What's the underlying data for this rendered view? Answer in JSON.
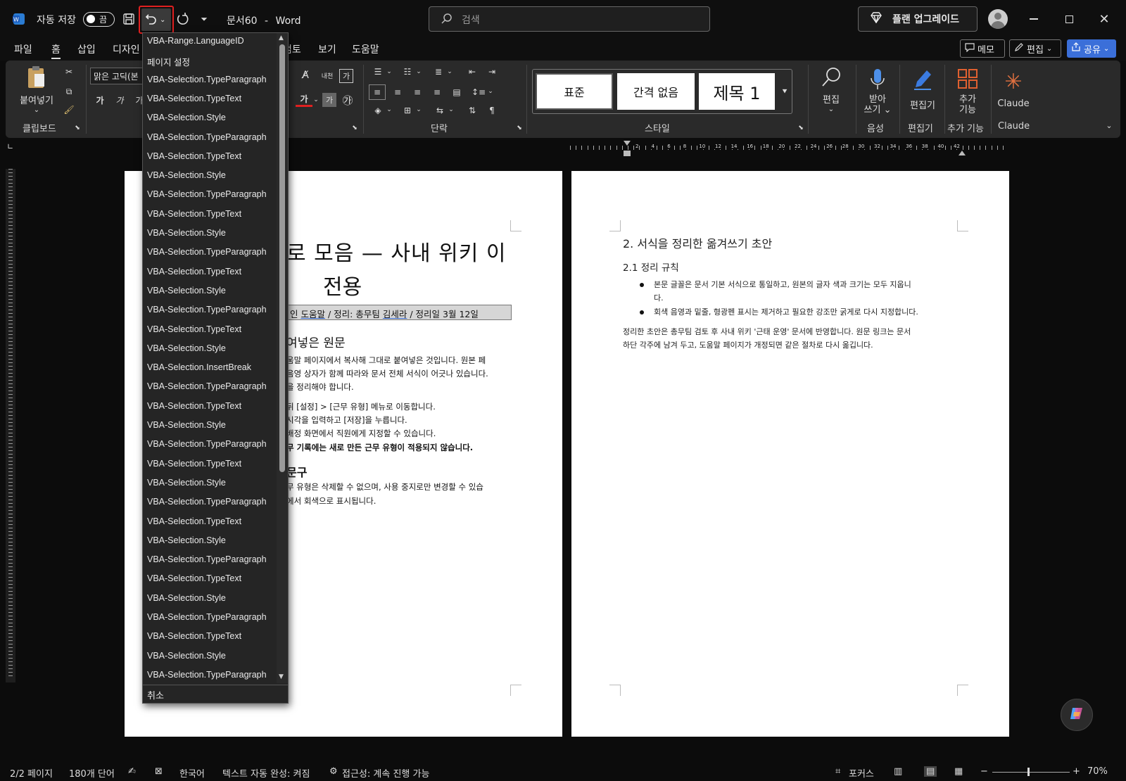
{
  "titlebar": {
    "autosave_label": "자동 저장",
    "autosave_state": "끔",
    "doc_title": "문서60",
    "separator": "-",
    "app_name": "Word",
    "search_placeholder": "검색",
    "upgrade_label": "플랜 업그레이드"
  },
  "menu": {
    "tabs": [
      "파일",
      "홈",
      "삽입",
      "디자인",
      "검토",
      "보기",
      "도움말"
    ],
    "active_tab": "홈",
    "memo_label": "메모",
    "edit_label": "편집",
    "share_label": "공유"
  },
  "ribbon": {
    "clipboard": {
      "paste": "붙여넣기",
      "group_label": "클립보드"
    },
    "font": {
      "font_name": "맑은 고딕(본",
      "bold": "가",
      "italic": "가",
      "underline": "가",
      "color": "가",
      "shade": "가",
      "hanja": "내천",
      "char_box": "가"
    },
    "paragraph": {
      "group_label": "단락"
    },
    "styles": {
      "items": [
        "표준",
        "간격 없음",
        "제목 1"
      ],
      "group_label": "스타일"
    },
    "editing": {
      "label": "편집"
    },
    "voice": {
      "label": "받아\n쓰기",
      "group_label": "음성"
    },
    "editor": {
      "label": "편집기",
      "group_label": "편집기"
    },
    "addins": {
      "label": "추가\n기능",
      "group_label": "추가 기능"
    },
    "claude": {
      "label": "Claude",
      "group_label": "Claude"
    }
  },
  "ruler_numbers": [
    "2",
    "4",
    "6",
    "8",
    "10",
    "12",
    "14",
    "16",
    "18",
    "20",
    "22",
    "24",
    "26",
    "28",
    "30",
    "32",
    "34",
    "36",
    "38",
    "40",
    "42"
  ],
  "undo_dropdown": {
    "items": [
      "VBA-Range.LanguageID",
      "페이지 설정",
      "VBA-Selection.TypeParagraph",
      "VBA-Selection.TypeText",
      "VBA-Selection.Style",
      "VBA-Selection.TypeParagraph",
      "VBA-Selection.TypeText",
      "VBA-Selection.Style",
      "VBA-Selection.TypeParagraph",
      "VBA-Selection.TypeText",
      "VBA-Selection.Style",
      "VBA-Selection.TypeParagraph",
      "VBA-Selection.TypeText",
      "VBA-Selection.Style",
      "VBA-Selection.TypeParagraph",
      "VBA-Selection.TypeText",
      "VBA-Selection.Style",
      "VBA-Selection.InsertBreak",
      "VBA-Selection.TypeParagraph",
      "VBA-Selection.TypeText",
      "VBA-Selection.Style",
      "VBA-Selection.TypeParagraph",
      "VBA-Selection.TypeText",
      "VBA-Selection.Style",
      "VBA-Selection.TypeParagraph",
      "VBA-Selection.TypeText",
      "VBA-Selection.Style",
      "VBA-Selection.TypeParagraph",
      "VBA-Selection.TypeText",
      "VBA-Selection.Style",
      "VBA-Selection.TypeParagraph",
      "VBA-Selection.TypeText",
      "VBA-Selection.Style",
      "VBA-Selection.TypeParagraph"
    ],
    "cancel": "취소"
  },
  "page1": {
    "title_line1": "로 모음 — 사내 위키 이",
    "title_line2": "전용",
    "meta_prefix": "인",
    "meta_link": "도움말",
    "meta_rest": "/ 정리: 총무팀",
    "meta_name": "김세라",
    "meta_date": "/ 정리일 3월 12일",
    "heading1": "여넣은 원문",
    "para1_line1": "움말 페이지에서 복사해 그대로 붙여넣은 것입니다. 원본 페",
    "para1_line2": "음영 상자가 함께 따라와 문서 전체 서식이 어긋나 있습니다.",
    "para1_line3": "을 정리해야 합니다.",
    "step1": "뒤 [설정] > [근무 유형] 메뉴로 이동합니다.",
    "step2": "시각을 입력하고 [저장]을 누릅니다.",
    "step3": "배정 화면에서 직원에게 지정할 수 있습니다.",
    "step4": "무 기록에는 새로 만든 근무 유형이 적용되지 않습니다.",
    "heading2": "문구",
    "para2_line1": "무 유형은 삭제할 수 없으며, 사용 중지로만 변경할 수 있습",
    "para2_line2": "에서 회색으로 표시됩니다."
  },
  "page2": {
    "heading": "2. 서식을 정리한 옮겨쓰기 초안",
    "subheading": "2.1 정리 규칙",
    "bullet1_line1": "본문 글꼴은 문서 기본 서식으로 통일하고, 원본의 글자 색과 크기는 모두 지웁니",
    "bullet1_line2": "다.",
    "bullet2": "회색 음영과 밑줄, 형광펜 표시는 제거하고 필요한 강조만 굵게로 다시 지정합니다.",
    "para_line1": "정리한 초안은 총무팀 검토 후 사내 위키 '근태 운영' 문서에 반영합니다. 원문 링크는 문서",
    "para_line2": "하단 각주에 남겨 두고, 도움말 페이지가 개정되면 같은 절차로 다시 옮깁니다."
  },
  "status": {
    "page": "2/2 페이지",
    "words": "180개 단어",
    "language": "한국어",
    "autocomplete": "텍스트 자동 완성: 켜짐",
    "accessibility": "접근성: 계속 진행 가능",
    "focus": "포커스",
    "zoom": "70%"
  },
  "colors": {
    "accent": "#4d7fe8",
    "highlight_outline": "#e02020",
    "share_bg": "#3b6fd9"
  }
}
